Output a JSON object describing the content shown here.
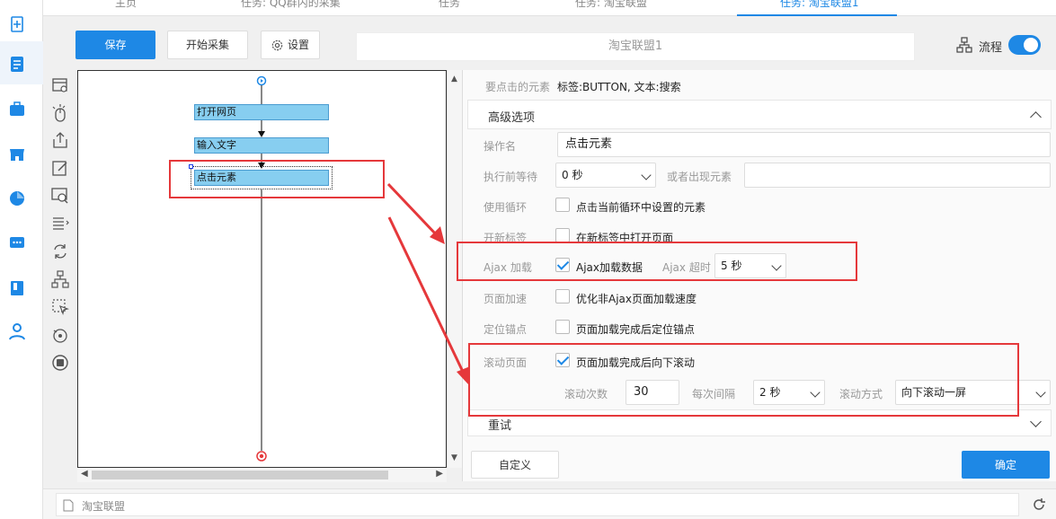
{
  "tabs": [
    {
      "label": "主页"
    },
    {
      "label": "任务: QQ群内的采集"
    },
    {
      "label": "任务"
    },
    {
      "label": "任务: 淘宝联盟"
    },
    {
      "label": "任务: 淘宝联盟1"
    }
  ],
  "toolbar": {
    "save_label": "保存",
    "start_label": "开始采集",
    "settings_label": "设置",
    "task_name": "淘宝联盟1",
    "flow_label": "流程",
    "flow_toggle": "on"
  },
  "flow": {
    "nodes": [
      {
        "label": "打开网页"
      },
      {
        "label": "输入文字"
      },
      {
        "label": "点击元素"
      }
    ]
  },
  "panel": {
    "target_label": "要点击的元素",
    "target_value": "标签:BUTTON, 文本:搜索",
    "advanced_label": "高级选项",
    "op_name_label": "操作名",
    "op_name_value": "点击元素",
    "wait_label": "执行前等待",
    "wait_value": "0 秒",
    "or_appear_label": "或者出现元素",
    "or_appear_value": "",
    "loop_label": "使用循环",
    "loop_cb_label": "点击当前循环中设置的元素",
    "newtab_label": "开新标签",
    "newtab_cb_label": "在新标签中打开页面",
    "ajax_label": "Ajax 加载",
    "ajax_cb_label": "Ajax加载数据",
    "ajax_timeout_label": "Ajax 超时",
    "ajax_timeout_value": "5 秒",
    "speed_label": "页面加速",
    "speed_cb_label": "优化非Ajax页面加载速度",
    "anchor_label": "定位锚点",
    "anchor_cb_label": "页面加载完成后定位锚点",
    "scroll_label": "滚动页面",
    "scroll_cb_label": "页面加载完成后向下滚动",
    "scroll_times_label": "滚动次数",
    "scroll_times_value": "30",
    "interval_label": "每次间隔",
    "interval_value": "2 秒",
    "scroll_mode_label": "滚动方式",
    "scroll_mode_value": "向下滚动一屏",
    "retry_label": "重试",
    "custom_label": "自定义",
    "ok_label": "确定"
  },
  "bottom": {
    "text": "淘宝联盟"
  }
}
